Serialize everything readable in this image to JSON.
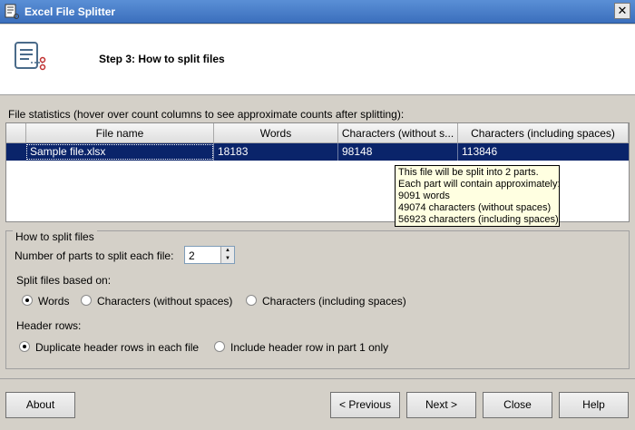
{
  "window": {
    "title": "Excel File Splitter",
    "close_glyph": "✕"
  },
  "header": {
    "step_title": "Step 3: How to split files",
    "icon": "document-scissors-icon"
  },
  "stats": {
    "label": "File statistics (hover over count columns to see approximate counts after splitting):",
    "columns": [
      "File name",
      "Words",
      "Characters (without s...",
      "Characters (including spaces)"
    ],
    "rows": [
      {
        "file": "Sample file.xlsx",
        "words": "18183",
        "chars_no_spaces": "98148",
        "chars_spaces": "113846"
      }
    ]
  },
  "tooltip": {
    "lines": [
      "This file will be split into 2 parts.",
      "Each part will contain approximately:",
      "9091 words",
      "49074 characters (without spaces)",
      "56923 characters (including spaces)"
    ]
  },
  "options": {
    "group_title": "How to split files",
    "parts_label": "Number of parts to split each file:",
    "parts_value": "2",
    "split_based_label": "Split files based on:",
    "split_options": [
      "Words",
      "Characters (without spaces)",
      "Characters (including spaces)"
    ],
    "split_selected": "Words",
    "header_rows_label": "Header rows:",
    "header_options": [
      "Duplicate header rows in each file",
      "Include header row in part 1 only"
    ],
    "header_selected": "Duplicate header rows in each file"
  },
  "buttons": {
    "about": "About",
    "previous": "< Previous",
    "next": "Next >",
    "close": "Close",
    "help": "Help"
  }
}
